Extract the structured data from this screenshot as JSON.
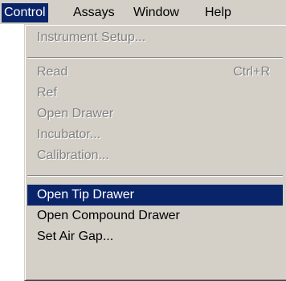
{
  "menubar": {
    "items": [
      {
        "label": "Control",
        "active": true
      },
      {
        "label": "Assays",
        "active": false
      },
      {
        "label": "Window",
        "active": false
      },
      {
        "label": "Help",
        "active": false
      }
    ]
  },
  "menu": {
    "items": [
      {
        "label": "Instrument Setup...",
        "shortcut": "",
        "enabled": false,
        "highlighted": false
      },
      {
        "label": "Read",
        "shortcut": "Ctrl+R",
        "enabled": false,
        "highlighted": false
      },
      {
        "label": "Ref",
        "shortcut": "",
        "enabled": false,
        "highlighted": false
      },
      {
        "label": "Open Drawer",
        "shortcut": "",
        "enabled": false,
        "highlighted": false
      },
      {
        "label": "Incubator...",
        "shortcut": "",
        "enabled": false,
        "highlighted": false
      },
      {
        "label": "Calibration...",
        "shortcut": "",
        "enabled": false,
        "highlighted": false
      },
      {
        "label": "Open Tip Drawer",
        "shortcut": "",
        "enabled": true,
        "highlighted": true
      },
      {
        "label": "Open Compound Drawer",
        "shortcut": "",
        "enabled": true,
        "highlighted": false
      },
      {
        "label": "Set Air Gap...",
        "shortcut": "",
        "enabled": true,
        "highlighted": false
      }
    ]
  },
  "colors": {
    "menu_background": "#d4d0c8",
    "highlight": "#0a246a",
    "highlight_text": "#ffffff",
    "disabled_text": "#808080"
  }
}
